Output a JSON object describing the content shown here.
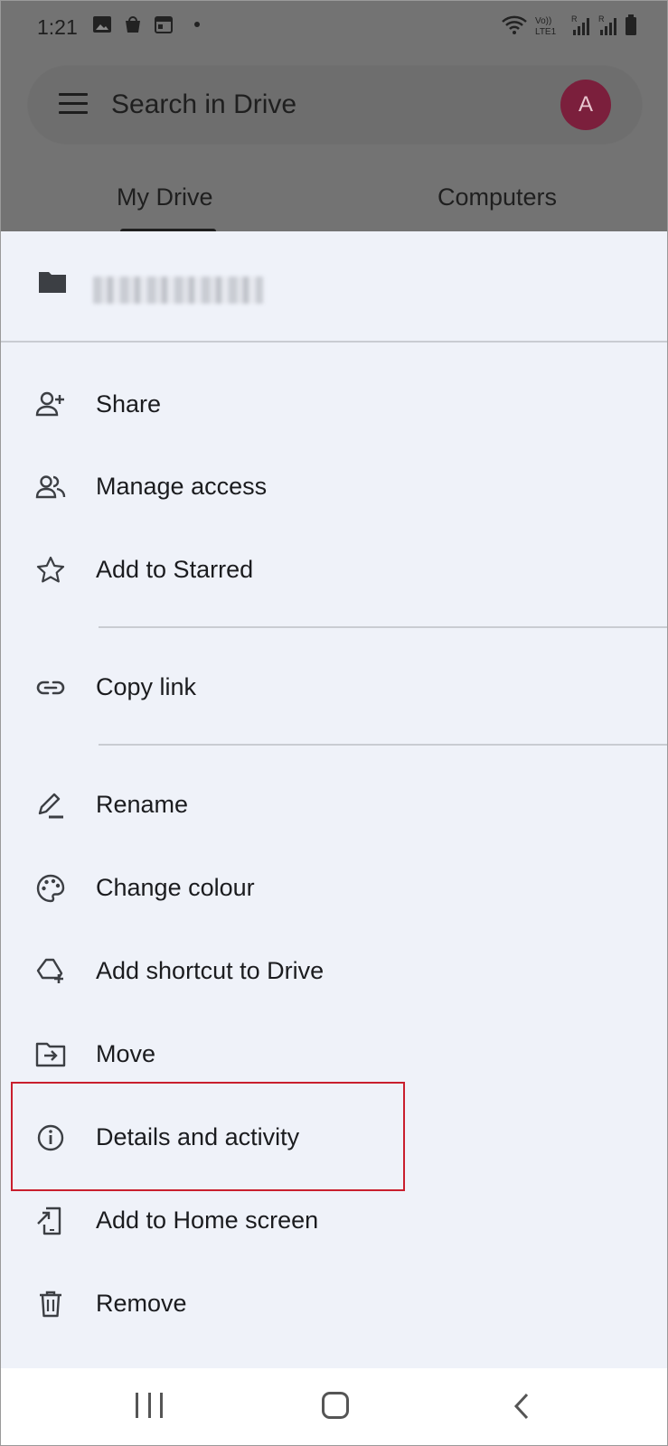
{
  "status_bar": {
    "time": "1:21",
    "icons_left": [
      "image-icon",
      "shopping-bag-icon",
      "calendar-icon"
    ],
    "icons_right": [
      "wifi-icon",
      "volte-icon",
      "signal-icon",
      "battery-icon"
    ],
    "volte_text_top": "Vo))",
    "volte_text_bottom": "LTE1",
    "sim_label": "R"
  },
  "search": {
    "placeholder": "Search in Drive",
    "avatar_letter": "A",
    "avatar_color": "#7b1f3c"
  },
  "tabs": [
    {
      "label": "My Drive",
      "active": true
    },
    {
      "label": "Computers",
      "active": false
    }
  ],
  "sheet": {
    "background": "#eff2f9",
    "items": [
      {
        "label": "Share",
        "icon": "person-add-icon"
      },
      {
        "label": "Manage access",
        "icon": "people-icon"
      },
      {
        "label": "Add to Starred",
        "icon": "star-icon"
      },
      {
        "label": "Copy link",
        "icon": "link-icon"
      },
      {
        "label": "Rename",
        "icon": "pencil-icon"
      },
      {
        "label": "Change colour",
        "icon": "palette-icon"
      },
      {
        "label": "Add shortcut to Drive",
        "icon": "drive-shortcut-icon"
      },
      {
        "label": "Move",
        "icon": "folder-move-icon"
      },
      {
        "label": "Details and activity",
        "icon": "info-icon"
      },
      {
        "label": "Add to Home screen",
        "icon": "add-to-home-icon"
      },
      {
        "label": "Remove",
        "icon": "trash-icon"
      }
    ]
  },
  "highlight_color": "#c91f2e"
}
